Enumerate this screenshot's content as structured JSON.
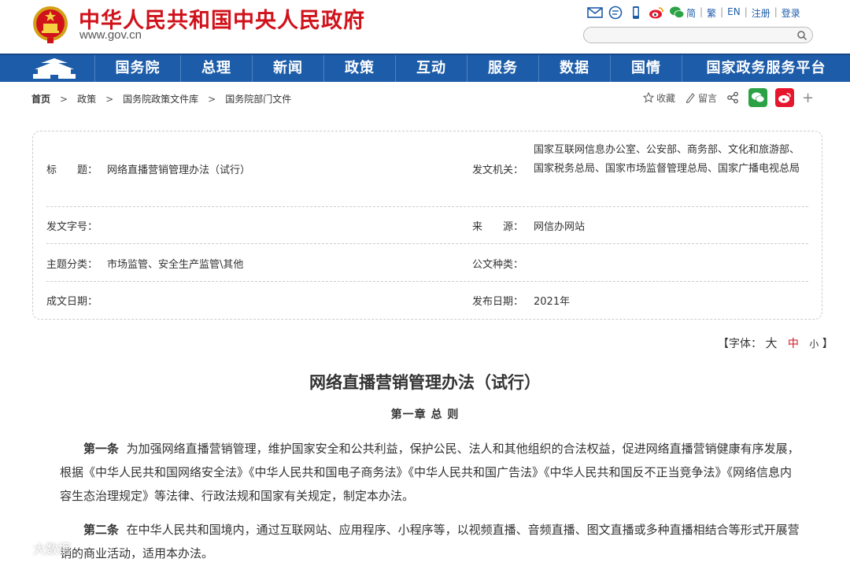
{
  "header": {
    "site_title": "中华人民共和国中央人民政府",
    "domain": "www.gov.cn",
    "lang_links": [
      "简",
      "繁",
      "EN",
      "注册",
      "登录"
    ],
    "search_placeholder": ""
  },
  "nav": {
    "items": [
      "国务院",
      "总理",
      "新闻",
      "政策",
      "互动",
      "服务",
      "数据",
      "国情",
      "国家政务服务平台"
    ]
  },
  "breadcrumb": {
    "items": [
      "首页",
      "政策",
      "国务院政策文件库",
      "国务院部门文件"
    ]
  },
  "share": {
    "favorite": "收藏",
    "comment": "留言"
  },
  "info": {
    "title_label": "标　　题：",
    "title_value": "网络直播营销管理办法（试行）",
    "org_label": "发文机关：",
    "org_value": "国家互联网信息办公室、公安部、商务部、文化和旅游部、国家税务总局、国家市场监督管理总局、国家广播电视总局",
    "docno_label": "发文字号：",
    "docno_value": "",
    "source_label": "来　　源：",
    "source_value": "网信办网站",
    "topic_label": "主题分类：",
    "topic_value": "市场监管、安全生产监管\\其他",
    "type_label": "公文种类：",
    "type_value": "",
    "date_label": "成文日期：",
    "date_value": "",
    "pubdate_label": "发布日期：",
    "pubdate_value": "2021年"
  },
  "fontsize": {
    "prefix": "【字体：",
    "big": "大",
    "mid": "中",
    "small": "小",
    "suffix": "】"
  },
  "article": {
    "title": "网络直播营销管理办法（试行）",
    "chapter": "第一章 总 则",
    "p1_label": "第一条",
    "p1_text": "为加强网络直播营销管理，维护国家安全和公共利益，保护公民、法人和其他组织的合法权益，促进网络直播营销健康有序发展，根据《中华人民共和国网络安全法》《中华人民共和国电子商务法》《中华人民共和国广告法》《中华人民共和国反不正当竞争法》《网络信息内容生态治理规定》等法律、行政法规和国家有关规定，制定本办法。",
    "p2_label": "第二条",
    "p2_text": "在中华人民共和国境内，通过互联网站、应用程序、小程序等，以视频直播、音频直播、图文直播或多种直播相结合等形式开展营销的商业活动，适用本办法。"
  },
  "watermark": {
    "text": "大数据"
  },
  "colors": {
    "brand_red": "#d0121b",
    "nav_blue": "#1d5ca8"
  }
}
